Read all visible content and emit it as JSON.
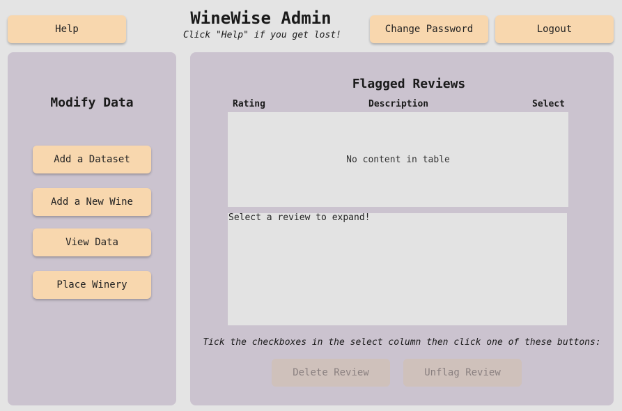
{
  "header": {
    "title": "WineWise Admin",
    "subtitle": "Click \"Help\" if you get lost!",
    "help_label": "Help",
    "change_password_label": "Change Password",
    "logout_label": "Logout"
  },
  "sidebar": {
    "heading": "Modify Data",
    "items": [
      {
        "label": "Add a Dataset"
      },
      {
        "label": "Add a New Wine"
      },
      {
        "label": "View Data"
      },
      {
        "label": "Place Winery"
      }
    ]
  },
  "main": {
    "heading": "Flagged Reviews",
    "columns": [
      "Rating",
      "Description",
      "Select"
    ],
    "empty_table_text": "No content in table",
    "expand_placeholder": "Select a review to expand!",
    "instruction": "Tick the checkboxes in the select column then click one of these buttons:",
    "delete_label": "Delete Review",
    "unflag_label": "Unflag Review"
  },
  "colors": {
    "background": "#e4e4e4",
    "panel": "#cbc3cf",
    "button": "#f8d7ae",
    "button_disabled": "#cfc1bb"
  }
}
